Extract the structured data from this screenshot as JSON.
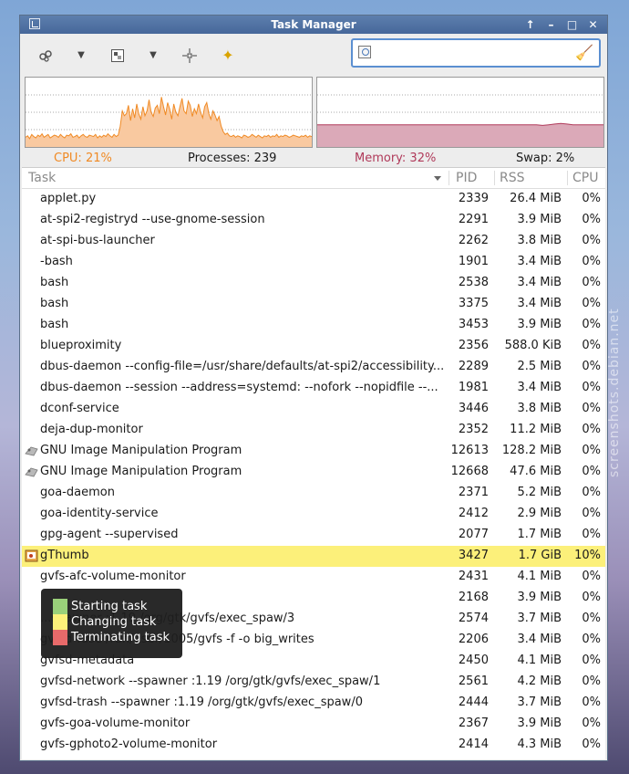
{
  "window": {
    "title": "Task Manager"
  },
  "search": {
    "placeholder": "",
    "value": ""
  },
  "status": {
    "cpu": "CPU: 21%",
    "processes": "Processes: 239",
    "memory": "Memory: 32%",
    "swap": "Swap: 2%"
  },
  "table": {
    "columns": {
      "task": "Task",
      "pid": "PID",
      "rss": "RSS",
      "cpu": "CPU"
    },
    "rows": [
      {
        "name": "applet.py",
        "pid": "2339",
        "rss": "26.4 MiB",
        "cpu": "0%"
      },
      {
        "name": "at-spi2-registryd --use-gnome-session",
        "pid": "2291",
        "rss": "3.9 MiB",
        "cpu": "0%"
      },
      {
        "name": "at-spi-bus-launcher",
        "pid": "2262",
        "rss": "3.8 MiB",
        "cpu": "0%"
      },
      {
        "name": "-bash",
        "pid": "1901",
        "rss": "3.4 MiB",
        "cpu": "0%"
      },
      {
        "name": "bash",
        "pid": "2538",
        "rss": "3.4 MiB",
        "cpu": "0%"
      },
      {
        "name": "bash",
        "pid": "3375",
        "rss": "3.4 MiB",
        "cpu": "0%"
      },
      {
        "name": "bash",
        "pid": "3453",
        "rss": "3.9 MiB",
        "cpu": "0%"
      },
      {
        "name": "blueproximity",
        "pid": "2356",
        "rss": "588.0 KiB",
        "cpu": "0%"
      },
      {
        "name": "dbus-daemon --config-file=/usr/share/defaults/at-spi2/accessibility...",
        "pid": "2289",
        "rss": "2.5 MiB",
        "cpu": "0%"
      },
      {
        "name": "dbus-daemon --session --address=systemd: --nofork --nopidfile --...",
        "pid": "1981",
        "rss": "3.4 MiB",
        "cpu": "0%"
      },
      {
        "name": "dconf-service",
        "pid": "3446",
        "rss": "3.8 MiB",
        "cpu": "0%"
      },
      {
        "name": "deja-dup-monitor",
        "pid": "2352",
        "rss": "11.2 MiB",
        "cpu": "0%"
      },
      {
        "name": "GNU Image Manipulation Program",
        "pid": "12613",
        "rss": "128.2 MiB",
        "cpu": "0%"
      },
      {
        "name": "GNU Image Manipulation Program",
        "pid": "12668",
        "rss": "47.6 MiB",
        "cpu": "0%"
      },
      {
        "name": "goa-daemon",
        "pid": "2371",
        "rss": "5.2 MiB",
        "cpu": "0%"
      },
      {
        "name": "goa-identity-service",
        "pid": "2412",
        "rss": "2.9 MiB",
        "cpu": "0%"
      },
      {
        "name": "gpg-agent --supervised",
        "pid": "2077",
        "rss": "1.7 MiB",
        "cpu": "0%"
      },
      {
        "name": "gThumb",
        "pid": "3427",
        "rss": "1.7 GiB",
        "cpu": "10%"
      },
      {
        "name": "gvfs-afc-volume-monitor",
        "pid": "2431",
        "rss": "4.1 MiB",
        "cpu": "0%"
      },
      {
        "name": "",
        "pid": "2168",
        "rss": "3.9 MiB",
        "cpu": "0%"
      },
      {
        "name": "...spawner :1.19 /org/gtk/gvfs/exec_spaw/3",
        "pid": "2574",
        "rss": "3.7 MiB",
        "cpu": "0%"
      },
      {
        "name": "gvfsd-fuse /run/user/1005/gvfs -f -o big_writes",
        "pid": "2206",
        "rss": "3.4 MiB",
        "cpu": "0%"
      },
      {
        "name": "gvfsd-metadata",
        "pid": "2450",
        "rss": "4.1 MiB",
        "cpu": "0%"
      },
      {
        "name": "gvfsd-network --spawner :1.19 /org/gtk/gvfs/exec_spaw/1",
        "pid": "2561",
        "rss": "4.2 MiB",
        "cpu": "0%"
      },
      {
        "name": "gvfsd-trash --spawner :1.19 /org/gtk/gvfs/exec_spaw/0",
        "pid": "2444",
        "rss": "3.7 MiB",
        "cpu": "0%"
      },
      {
        "name": "gvfs-goa-volume-monitor",
        "pid": "2367",
        "rss": "3.9 MiB",
        "cpu": "0%"
      },
      {
        "name": "gvfs-gphoto2-volume-monitor",
        "pid": "2414",
        "rss": "4.3 MiB",
        "cpu": "0%"
      }
    ]
  },
  "tooltip": {
    "items": [
      {
        "label": "Starting task",
        "color": "#9ad07a"
      },
      {
        "label": "Changing task",
        "color": "#fcf07a"
      },
      {
        "label": "Terminating task",
        "color": "#e86a6a"
      }
    ]
  },
  "watermark": "screenshots.debian.net",
  "colors": {
    "cpu": "#f08a24",
    "cpu_fill": "#f9c9a0",
    "memory": "#b03a5a",
    "memory_fill": "#dba9b8",
    "highlight": "#fcf07a"
  },
  "graphs": {
    "cpu_percent": [
      14,
      16,
      12,
      18,
      15,
      13,
      17,
      15,
      19,
      14,
      16,
      18,
      13,
      15,
      17,
      16,
      14,
      18,
      15,
      13,
      17,
      16,
      19,
      14,
      15,
      17,
      13,
      16,
      18,
      15,
      14,
      17,
      16,
      15,
      18,
      13,
      16,
      14,
      17,
      15,
      19,
      16,
      14,
      18,
      15,
      17,
      30,
      52,
      45,
      48,
      60,
      38,
      55,
      42,
      62,
      48,
      40,
      58,
      45,
      52,
      68,
      50,
      44,
      56,
      60,
      48,
      72,
      58,
      46,
      64,
      55,
      40,
      62,
      50,
      45,
      58,
      70,
      52,
      48,
      66,
      60,
      44,
      55,
      48,
      62,
      50,
      42,
      58,
      64,
      48,
      40,
      52,
      46,
      38,
      44,
      30,
      22,
      18,
      20,
      16,
      15,
      17,
      14,
      16,
      15,
      13,
      17,
      16,
      14,
      15,
      18,
      16,
      14,
      17,
      15,
      13,
      16,
      15,
      17,
      14,
      16,
      15,
      18,
      14,
      16,
      15,
      17,
      16,
      14,
      15,
      17,
      16,
      15,
      14,
      16,
      15,
      17,
      14,
      16,
      15
    ],
    "memory_percent": [
      32,
      32,
      32,
      32,
      32,
      32,
      32,
      32,
      32,
      32,
      32,
      32,
      32,
      32,
      32,
      32,
      32,
      32,
      32,
      32,
      32,
      32,
      32,
      32,
      32,
      32,
      32,
      32,
      32,
      32,
      32,
      32,
      32,
      32,
      32,
      32,
      32,
      31,
      32,
      33,
      34,
      33,
      32,
      32,
      32,
      32,
      32,
      32
    ]
  }
}
